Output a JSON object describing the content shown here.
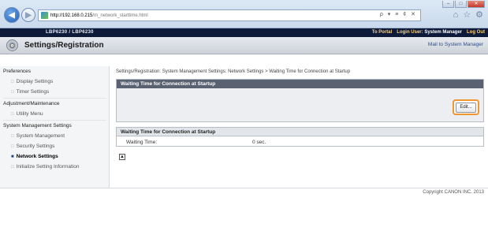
{
  "browser": {
    "url_host": "http://192.168.0.215",
    "url_path": "/m_network_starttime.html",
    "tools": "ρ ▾ ≡ ¢ ✕",
    "icons": [
      "home-icon",
      "star-icon",
      "gear-icon"
    ],
    "window_controls": [
      "–",
      "□",
      "✕"
    ]
  },
  "printer_bar": {
    "model": "LBP6230 / LBP6230",
    "to_portal": "To Portal",
    "login_user_label": "Login User:",
    "login_user_value": "System Manager",
    "logout": "Log Out"
  },
  "header": {
    "title": "Settings/Registration",
    "mail_link": "Mail to System Manager"
  },
  "sidebar": {
    "groups": [
      {
        "heading": "Preferences",
        "items": [
          "Display Settings",
          "Timer Settings"
        ]
      },
      {
        "heading": "Adjustment/Maintenance",
        "items": [
          "Utility Menu"
        ]
      },
      {
        "heading": "System Management Settings",
        "items": [
          "System Management",
          "Security Settings",
          "Network Settings",
          "Initialize Setting Information"
        ]
      }
    ],
    "active_item": "Network Settings"
  },
  "main": {
    "breadcrumb": "Settings/Registration: System Management Settings: Network Settings > Waiting Time for Connection at Startup",
    "section_title": "Waiting Time for Connection at Startup",
    "edit_button": "Edit...",
    "detail_title": "Waiting Time for Connection at Startup",
    "waiting_time_label": "Waiting Time:",
    "waiting_time_value": "0 sec."
  },
  "footer": {
    "copyright": "Copyright CANON INC. 2013"
  },
  "colors": {
    "printer_bar_bg": "#0d1a3a",
    "highlight": "#f0962c",
    "section_header_bg": "#5a6272"
  }
}
